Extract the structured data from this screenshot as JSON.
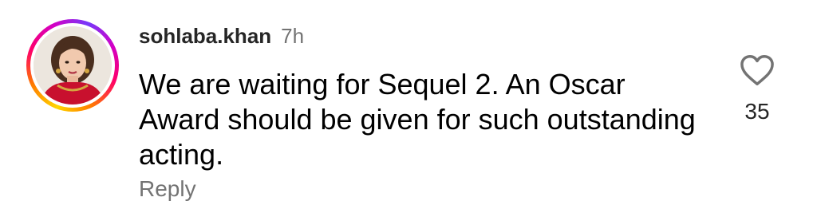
{
  "comment": {
    "username": "sohlaba.khan",
    "timestamp": "7h",
    "text": "We are waiting for Sequel 2. An Oscar Award should be given for such outstanding acting.",
    "reply_label": "Reply",
    "like_count": "35"
  },
  "icons": {
    "like": "heart-outline-icon",
    "avatar": "user-profile-photo"
  },
  "colors": {
    "username": "#262626",
    "secondary_text": "#737373",
    "story_ring": [
      "#ffd600",
      "#ff7a00",
      "#ff0069",
      "#d300c5",
      "#7638fa"
    ]
  }
}
